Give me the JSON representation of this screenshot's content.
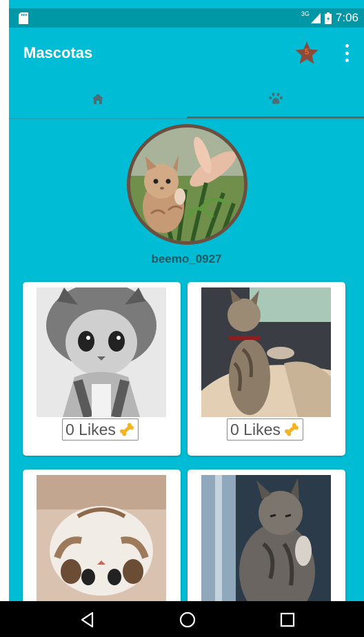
{
  "status_bar": {
    "network": "3G",
    "time": "7:06"
  },
  "app_bar": {
    "title": "Mascotas",
    "favorites_count": "5"
  },
  "tabs": [
    {
      "icon": "home-icon"
    },
    {
      "icon": "paw-icon",
      "selected": true
    }
  ],
  "profile": {
    "username": "beemo_0927"
  },
  "pets": [
    {
      "likes_label": "0 Likes",
      "icon": "bone-icon"
    },
    {
      "likes_label": "0 Likes",
      "icon": "bone-icon"
    },
    {
      "likes_label": "",
      "icon": "bone-icon"
    },
    {
      "likes_label": "",
      "icon": "bone-icon"
    }
  ],
  "colors": {
    "primary": "#00BCD4",
    "primary_dark": "#0097A7",
    "star": "#8B4A3A",
    "accent": "#FF5722"
  }
}
